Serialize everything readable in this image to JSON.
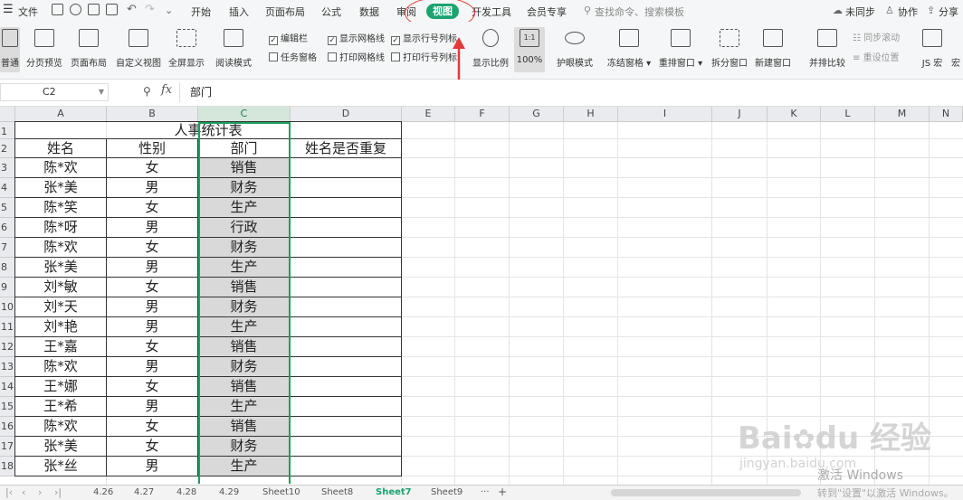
{
  "menu": {
    "items": [
      "文件",
      "开始",
      "插入",
      "页面布局",
      "公式",
      "数据",
      "审阅",
      "视图",
      "开发工具",
      "会员专享"
    ],
    "active_tab": "视图",
    "search_placeholder": "查找命令、搜索模板",
    "right": {
      "sync": "未同步",
      "collab": "协作",
      "share": "分享"
    }
  },
  "ribbon": {
    "normal": "普通",
    "page_break": "分页预览",
    "page_layout": "页面布局",
    "custom_view": "自定义视图",
    "fullscreen": "全屏显示",
    "reading": "阅读模式",
    "show_ratio": "显示比例",
    "zoom_level": "100%",
    "zoom_icon": "1:1",
    "eye_mode": "护眼模式",
    "freeze": "冻结窗格",
    "rearrange": "重排窗口",
    "split": "拆分窗口",
    "new_window": "新建窗口",
    "side_by_side": "并排比较",
    "sync_scroll": "同步滚动",
    "reset_pos": "重设位置",
    "js_macro": "JS 宏",
    "macro": "宏",
    "checks": {
      "edit_bar": {
        "label": "编辑栏",
        "checked": true
      },
      "show_grid": {
        "label": "显示网格线",
        "checked": true
      },
      "show_headers": {
        "label": "显示行号列标",
        "checked": true
      },
      "task_pane": {
        "label": "任务窗格",
        "checked": false
      },
      "print_grid": {
        "label": "打印网格线",
        "checked": false
      },
      "print_headers": {
        "label": "打印行号列标",
        "checked": false
      }
    }
  },
  "formula_bar": {
    "name_box": "C2",
    "fx": "fx",
    "content": "部门"
  },
  "sheet": {
    "columns": [
      "A",
      "B",
      "C",
      "D",
      "E",
      "F",
      "G",
      "H",
      "I",
      "J",
      "K",
      "L",
      "M",
      "N"
    ],
    "rows": [
      "1",
      "2",
      "3",
      "4",
      "5",
      "6",
      "7",
      "8",
      "9",
      "10",
      "11",
      "12",
      "13",
      "14",
      "15",
      "16",
      "17",
      "18"
    ],
    "title": "人事统计表",
    "headers": [
      "姓名",
      "性别",
      "部门",
      "姓名是否重复"
    ],
    "data": [
      [
        "陈*欢",
        "女",
        "销售"
      ],
      [
        "张*美",
        "男",
        "财务"
      ],
      [
        "陈*笑",
        "女",
        "生产"
      ],
      [
        "陈*呀",
        "男",
        "行政"
      ],
      [
        "陈*欢",
        "女",
        "财务"
      ],
      [
        "张*美",
        "男",
        "生产"
      ],
      [
        "刘*敏",
        "女",
        "销售"
      ],
      [
        "刘*天",
        "男",
        "财务"
      ],
      [
        "刘*艳",
        "男",
        "生产"
      ],
      [
        "王*嘉",
        "女",
        "销售"
      ],
      [
        "陈*欢",
        "男",
        "财务"
      ],
      [
        "王*娜",
        "女",
        "销售"
      ],
      [
        "王*希",
        "男",
        "生产"
      ],
      [
        "陈*欢",
        "女",
        "销售"
      ],
      [
        "张*美",
        "女",
        "财务"
      ],
      [
        "张*丝",
        "男",
        "生产"
      ]
    ]
  },
  "tabs": [
    "4.26",
    "4.27",
    "4.28",
    "4.29",
    "Sheet10",
    "Sheet8",
    "Sheet7",
    "Sheet9"
  ],
  "active_sheet": "Sheet7",
  "tab_more": "···",
  "tab_add": "+",
  "watermark": {
    "brand": "Bai",
    "brand2": "du",
    "brand_cn": "经验",
    "url": "jingyan.baidu.com"
  },
  "activation": {
    "line1": "激活 Windows",
    "line2": "转到\"设置\"以激活 Windows。"
  },
  "colors": {
    "accent": "#1aa36f",
    "selection": "#1e9e5e",
    "arrow": "#e23a3a"
  }
}
